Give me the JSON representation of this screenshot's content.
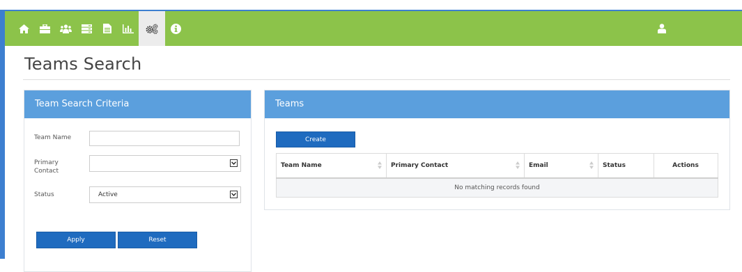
{
  "nav": {
    "items": [
      {
        "name": "home-icon"
      },
      {
        "name": "briefcase-icon"
      },
      {
        "name": "users-icon"
      },
      {
        "name": "server-icon"
      },
      {
        "name": "document-icon"
      },
      {
        "name": "bar-chart-icon"
      },
      {
        "name": "gears-icon",
        "active": true
      },
      {
        "name": "info-icon"
      }
    ],
    "user_icon": "user-icon",
    "bar_color": "#8cc34a"
  },
  "page": {
    "title": "Teams Search"
  },
  "criteria": {
    "heading": "Team Search Criteria",
    "team_name_label": "Team Name",
    "team_name_value": "",
    "primary_contact_label": "Primary Contact",
    "primary_contact_value": "",
    "status_label": "Status",
    "status_value": "Active",
    "apply_label": "Apply",
    "reset_label": "Reset"
  },
  "teams": {
    "heading": "Teams",
    "create_label": "Create",
    "columns": [
      "Team Name",
      "Primary Contact",
      "Email",
      "Status",
      "Actions"
    ],
    "empty_message": "No matching records found"
  },
  "colors": {
    "panel_header": "#5b9fdd",
    "button": "#1f6bbf",
    "accent_border": "#3d7fd0"
  }
}
